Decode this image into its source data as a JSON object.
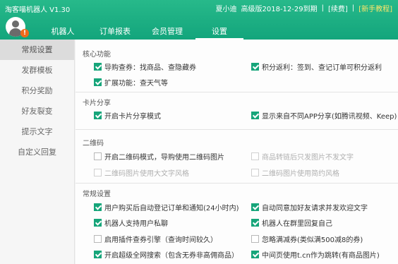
{
  "app": {
    "title": "淘客喵机器人 V1.30"
  },
  "user": {
    "name": "夏小迪",
    "plan": "高级版2018-12-29到期",
    "renew": "[续费]",
    "guide": "[新手教程]"
  },
  "nav": [
    "机器人",
    "订单报表",
    "会员管理",
    "设置"
  ],
  "sidebar": [
    "常规设置",
    "发群模板",
    "积分奖励",
    "好友裂变",
    "提示文字",
    "自定义回复"
  ],
  "sections": {
    "core": {
      "title": "核心功能",
      "options": [
        "导购查券：找商品、查隐藏券",
        "积分返利：签到、查记订单可积分返利",
        "扩展功能：查天气等"
      ]
    },
    "card": {
      "title": "卡片分享",
      "options": [
        "开启卡片分享模式",
        "显示来自不同APP分享(如腾讯视频、Keep)"
      ]
    },
    "qr": {
      "title": "二维码",
      "options": [
        "开启二维码模式，导购使用二维码图片",
        "商品转链后只发图片不发文字",
        "二维码图片使用大文字风格",
        "二维码图片使用简约风格"
      ]
    },
    "general": {
      "title": "常规设置",
      "options": [
        "用户购买后自动登记订单和通知(24小时内)",
        "自动同意加好友请求并发欢迎文字",
        "机器人支持用户私聊",
        "机器人在群里回复自己",
        "启用插件查券引擎（查询时间较久）",
        "忽略满减券(类似满500减8的券)",
        "开启超级全网搜索（包含无券非高佣商品）",
        "中间页使用t.cn作为跳转(有商品图片)"
      ]
    }
  }
}
